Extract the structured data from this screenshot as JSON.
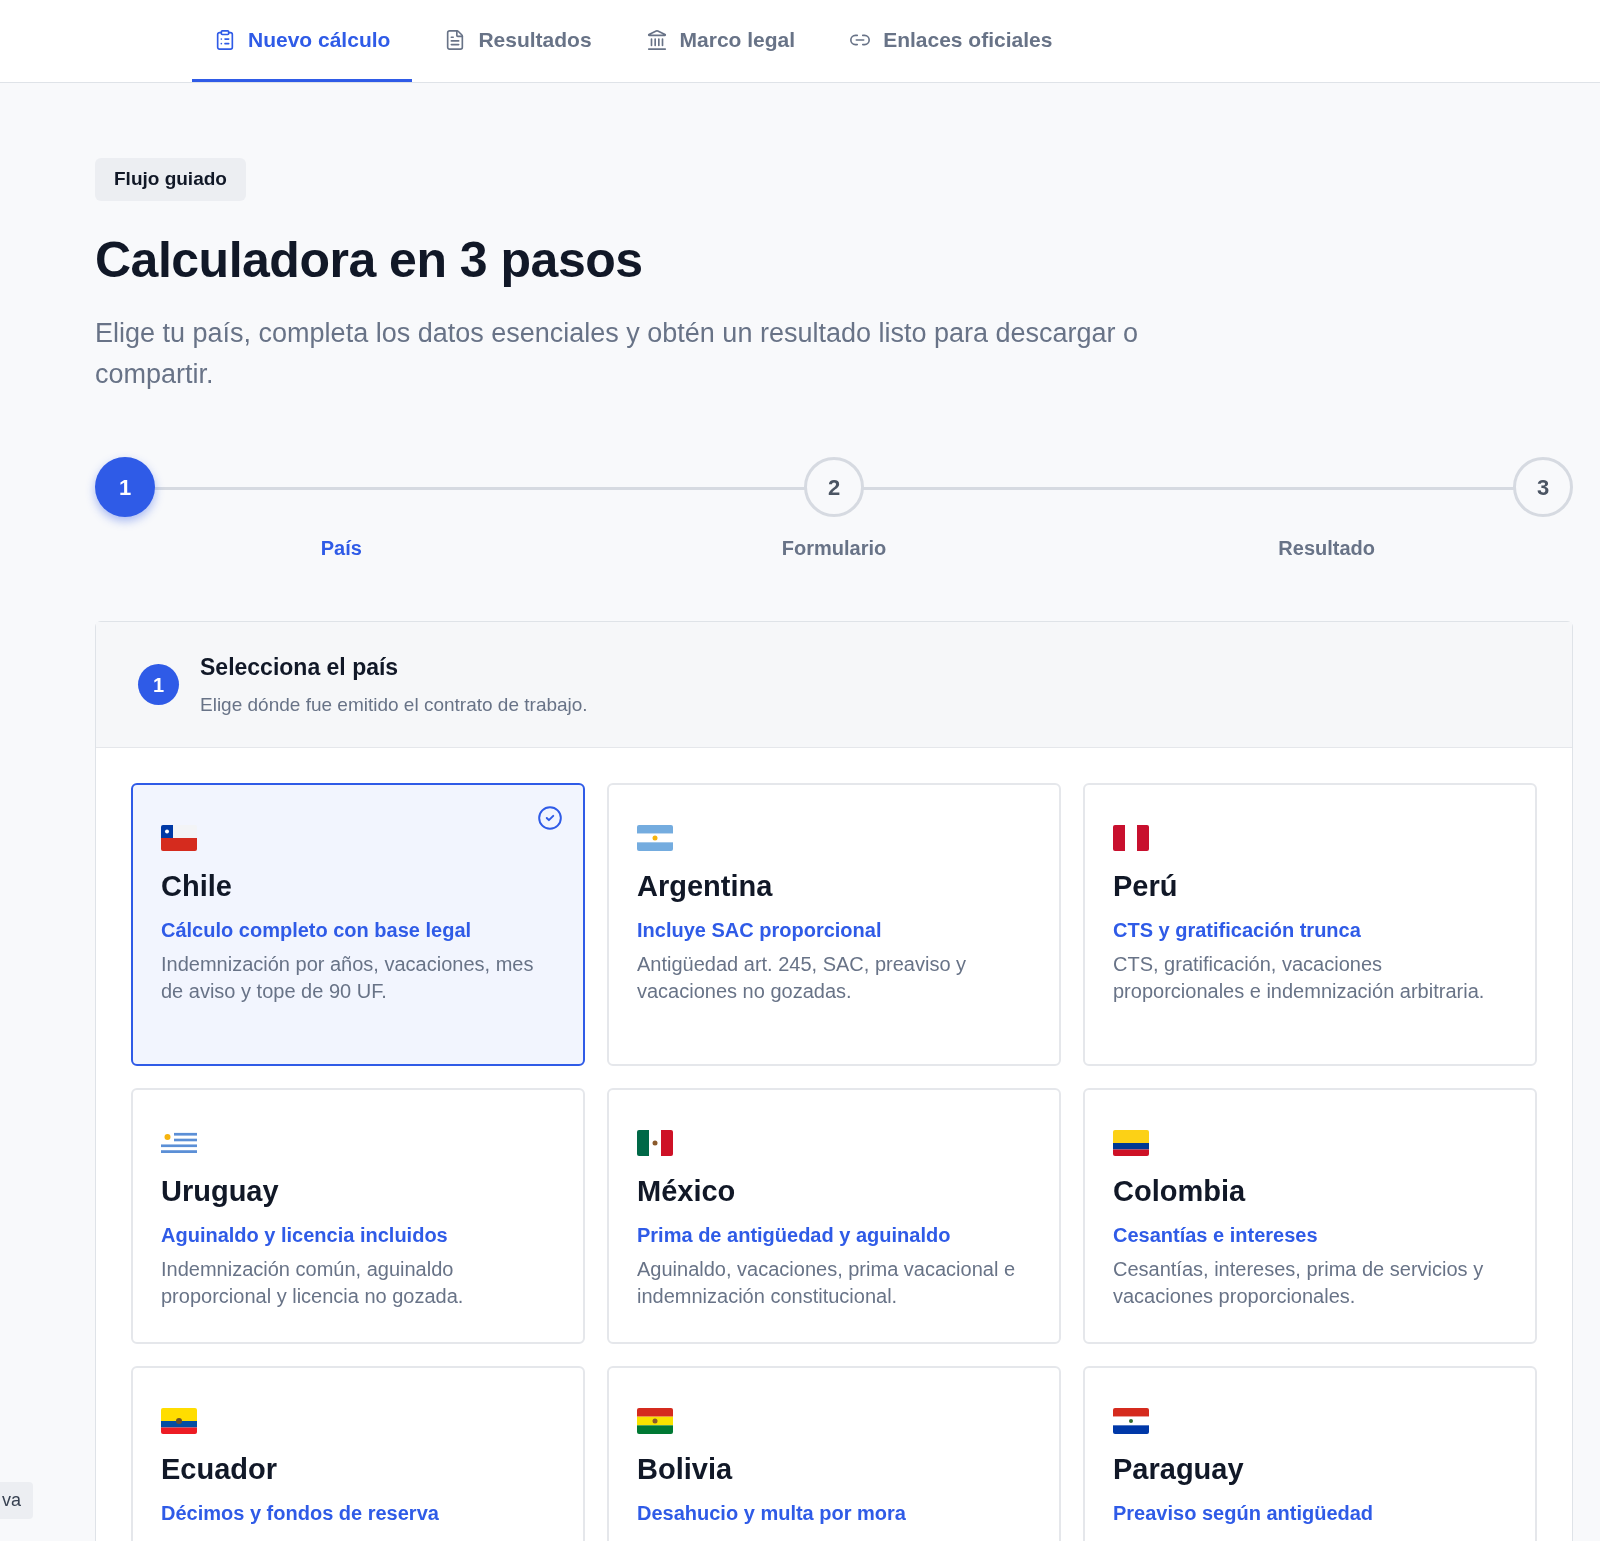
{
  "nav": {
    "tabs": [
      {
        "label": "Nuevo cálculo",
        "selected": true
      },
      {
        "label": "Resultados",
        "selected": false
      },
      {
        "label": "Marco legal",
        "selected": false
      },
      {
        "label": "Enlaces oficiales",
        "selected": false
      }
    ]
  },
  "hero": {
    "badge": "Flujo guiado",
    "title": "Calculadora en 3 pasos",
    "description": "Elige tu país, completa los datos esenciales y obtén un resultado listo para descargar o compartir."
  },
  "stepper": [
    {
      "number": "1",
      "label": "País",
      "selected": true
    },
    {
      "number": "2",
      "label": "Formulario",
      "selected": false
    },
    {
      "number": "3",
      "label": "Resultado",
      "selected": false
    }
  ],
  "panel": {
    "step": "1",
    "title": "Selecciona el país",
    "subtitle": "Elige dónde fue emitido el contrato de trabajo.",
    "countries": [
      {
        "name": "Chile",
        "highlight": "Cálculo completo con base legal",
        "description": "Indemnización por años, vacaciones, mes de aviso y tope de 90 UF.",
        "selected": true
      },
      {
        "name": "Argentina",
        "highlight": "Incluye SAC proporcional",
        "description": "Antigüedad art. 245, SAC, preaviso y vacaciones no gozadas.",
        "selected": false
      },
      {
        "name": "Perú",
        "highlight": "CTS y gratificación trunca",
        "description": "CTS, gratificación, vacaciones proporcionales e indemnización arbitraria.",
        "selected": false
      },
      {
        "name": "Uruguay",
        "highlight": "Aguinaldo y licencia incluidos",
        "description": "Indemnización común, aguinaldo proporcional y licencia no gozada.",
        "selected": false
      },
      {
        "name": "México",
        "highlight": "Prima de antigüedad y aguinaldo",
        "description": "Aguinaldo, vacaciones, prima vacacional e indemnización constitucional.",
        "selected": false
      },
      {
        "name": "Colombia",
        "highlight": "Cesantías e intereses",
        "description": "Cesantías, intereses, prima de servicios y vacaciones proporcionales.",
        "selected": false
      },
      {
        "name": "Ecuador",
        "highlight": "Décimos y fondos de reserva",
        "selected": false
      },
      {
        "name": "Bolivia",
        "highlight": "Desahucio y multa por mora",
        "selected": false
      },
      {
        "name": "Paraguay",
        "highlight": "Preaviso según antigüedad",
        "selected": false
      }
    ]
  },
  "toast": "va"
}
